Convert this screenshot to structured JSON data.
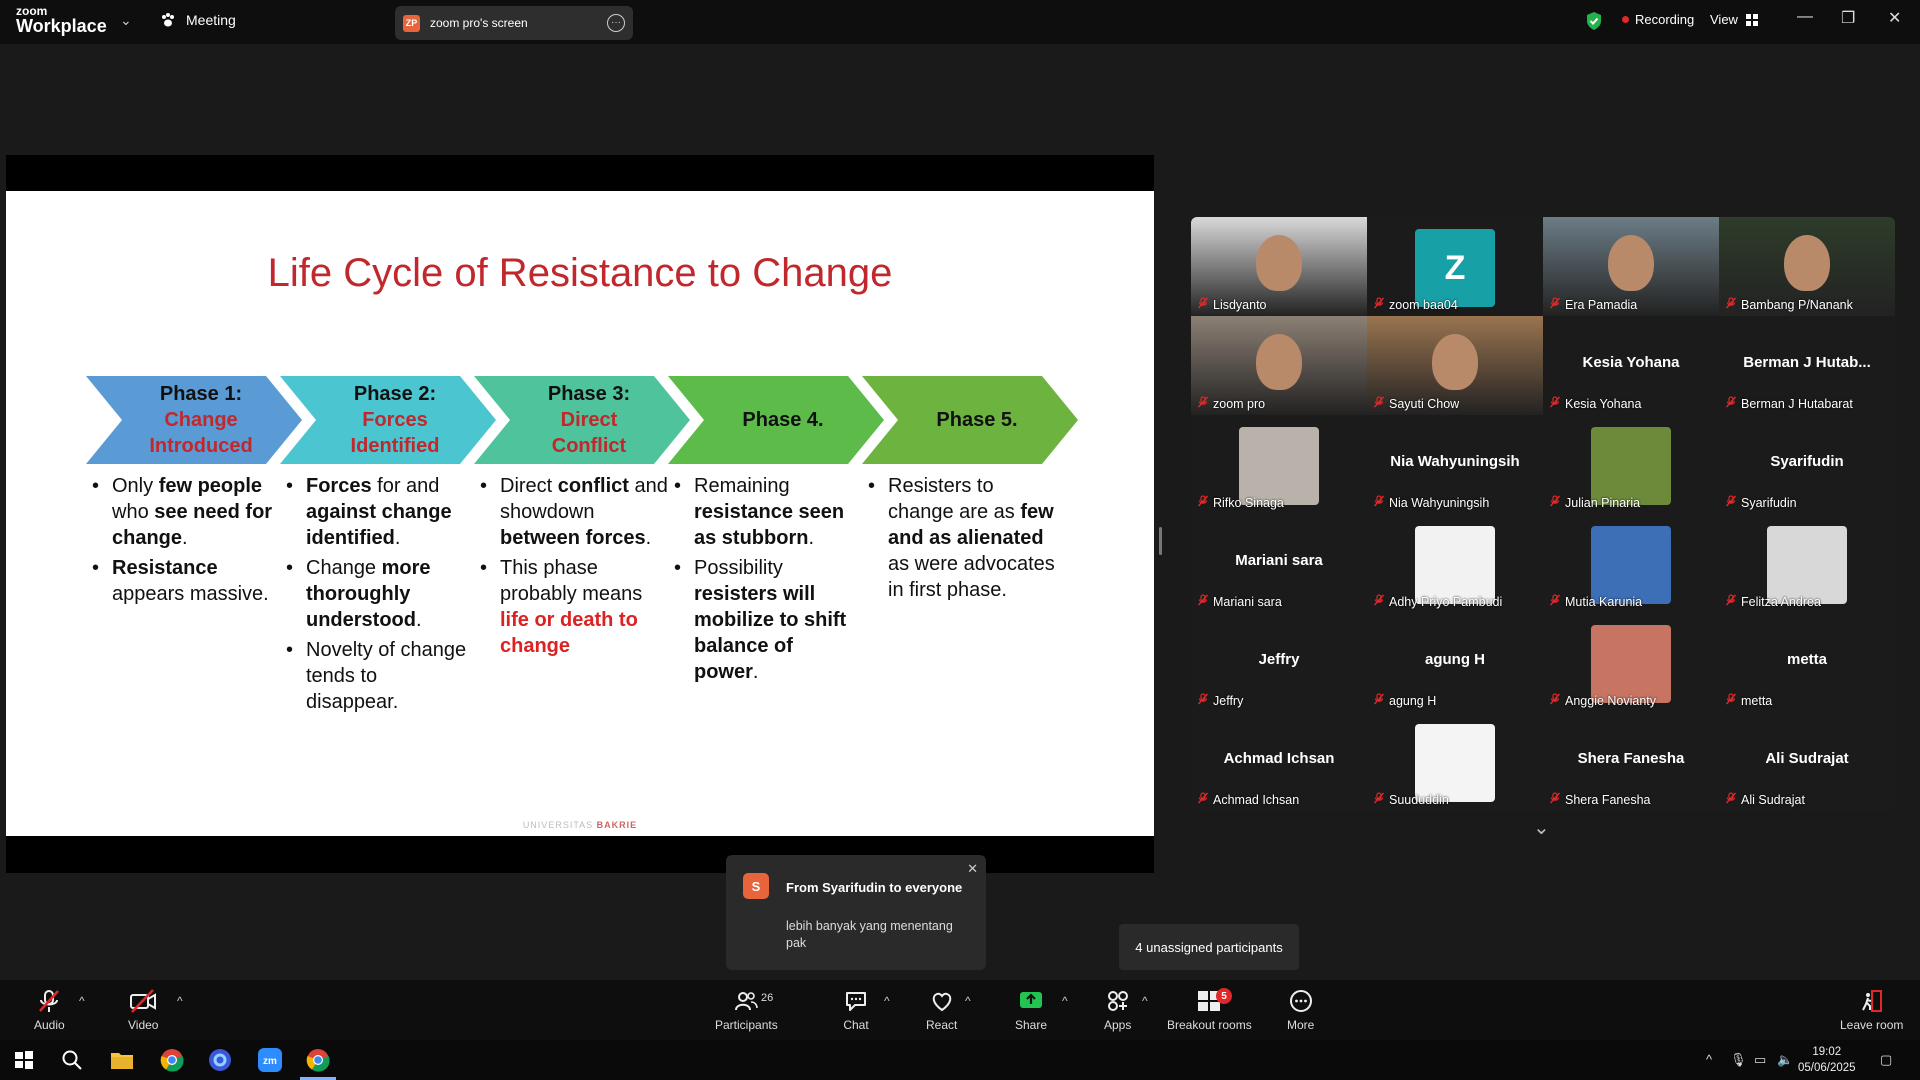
{
  "topbar": {
    "logo_line1": "zoom",
    "logo_line2": "Workplace",
    "meeting_label": "Meeting",
    "share_badge": "ZP",
    "share_title": "zoom pro's screen",
    "recording_label": "Recording",
    "view_label": "View"
  },
  "slide": {
    "title": "Life Cycle of Resistance to Change",
    "phases": [
      {
        "num": "Phase 1:",
        "sub1": "Change",
        "sub2": "Introduced",
        "color": "#5b9bd5"
      },
      {
        "num": "Phase 2:",
        "sub1": "Forces",
        "sub2": "Identified",
        "color": "#4bc6d0"
      },
      {
        "num": "Phase 3:",
        "sub1": "Direct",
        "sub2": "Conflict",
        "color": "#4fc39b"
      },
      {
        "num": "Phase 4.",
        "sub1": "",
        "sub2": "",
        "color": "#5dbb4a"
      },
      {
        "num": "Phase 5.",
        "sub1": "",
        "sub2": "",
        "color": "#6cb33f"
      }
    ],
    "col1": {
      "b1_a": "Only ",
      "b1_b": "few people",
      "b1_c": " who ",
      "b1_d": "see need for change",
      "b1_e": ".",
      "b2_a": "Resistance",
      "b2_b": " appears massive."
    },
    "col2": {
      "b1_a": "Forces",
      "b1_b": " for and ",
      "b1_c": "against change identified",
      "b1_d": ".",
      "b2_a": "Change ",
      "b2_b": "more thoroughly understood",
      "b2_c": ".",
      "b3": "Novelty of change tends to disappear."
    },
    "col3": {
      "b1_a": "Direct ",
      "b1_b": "conflict",
      "b1_c": " and showdown ",
      "b1_d": "between forces",
      "b1_e": ".",
      "b2_a": "This phase probably means ",
      "b2_b": "life or death to change"
    },
    "col4": {
      "b1_a": "Remaining ",
      "b1_b": "resistance seen as stubborn",
      "b1_c": ".",
      "b2_a": "Possibility ",
      "b2_b": "resisters will mobilize to shift balance of power",
      "b2_c": "."
    },
    "col5": {
      "b1_a": "Resisters to change are as ",
      "b1_b": "few and as alienated",
      "b1_c": " as were advocates in first phase."
    },
    "footer_a": "UNIVERSITAS",
    "footer_b": "BAKRIE"
  },
  "participants_gallery": [
    {
      "label": "Lisdyanto",
      "center": "",
      "type": "video",
      "bg": "#d9d9d9"
    },
    {
      "label": "zoom baa04",
      "center": "",
      "type": "avatar",
      "avatar_letter": "Z",
      "bg": "#1b1b1b",
      "avatar_color": "#17a0a6"
    },
    {
      "label": "Era Pamadia",
      "center": "",
      "type": "video",
      "bg": "#6c7d86"
    },
    {
      "label": "Bambang P/Nanank",
      "center": "",
      "type": "video",
      "bg": "#2e3c2a"
    },
    {
      "label": "zoom pro",
      "center": "",
      "type": "video",
      "bg": "#8c8074",
      "active": true
    },
    {
      "label": "Sayuti Chow",
      "center": "",
      "type": "video",
      "bg": "#9a7450"
    },
    {
      "label": "Kesia Yohana",
      "center": "Kesia Yohana",
      "type": "name"
    },
    {
      "label": "Berman J Hutabarat",
      "center": "Berman J Hutab...",
      "type": "name"
    },
    {
      "label": "Rifko Sinaga",
      "center": "",
      "type": "avatar",
      "bg": "#1b1b1b",
      "avatar_color": "#b9b2aa"
    },
    {
      "label": "Nia Wahyuningsih",
      "center": "Nia Wahyuningsih",
      "type": "name"
    },
    {
      "label": "Julian Pinaria",
      "center": "",
      "type": "avatar",
      "bg": "#1b1b1b",
      "avatar_color": "#6d8a3a"
    },
    {
      "label": "Syarifudin",
      "center": "Syarifudin",
      "type": "name"
    },
    {
      "label": "Mariani sara",
      "center": "Mariani sara",
      "type": "name"
    },
    {
      "label": "Adhy Priyo Pambudi",
      "center": "",
      "type": "avatar",
      "bg": "#1b1b1b",
      "avatar_color": "#f2f2f2"
    },
    {
      "label": "Mutia Karunia",
      "center": "",
      "type": "avatar",
      "bg": "#1b1b1b",
      "avatar_color": "#3d6fb6"
    },
    {
      "label": "Felitza Andrea",
      "center": "",
      "type": "avatar",
      "bg": "#1b1b1b",
      "avatar_color": "#d8d8d8"
    },
    {
      "label": "Jeffry",
      "center": "Jeffry",
      "type": "name"
    },
    {
      "label": "agung H",
      "center": "agung H",
      "type": "name"
    },
    {
      "label": "Anggie Novianty",
      "center": "",
      "type": "avatar",
      "bg": "#1b1b1b",
      "avatar_color": "#c77463"
    },
    {
      "label": "metta",
      "center": "metta",
      "type": "name"
    },
    {
      "label": "Achmad Ichsan",
      "center": "Achmad Ichsan",
      "type": "name"
    },
    {
      "label": "Suududdin",
      "center": "",
      "type": "avatar",
      "bg": "#1b1b1b",
      "avatar_color": "#f4f4f4"
    },
    {
      "label": "Shera Fanesha",
      "center": "Shera Fanesha",
      "type": "name"
    },
    {
      "label": "Ali Sudrajat",
      "center": "Ali Sudrajat",
      "type": "name"
    }
  ],
  "chat_toast": {
    "avatar": "S",
    "from": "From Syarifudin to everyone",
    "message": "lebih banyak yang menentang pak"
  },
  "unassigned": "4 unassigned participants",
  "toolbar": {
    "audio": "Audio",
    "video": "Video",
    "participants": "Participants",
    "participants_count": "26",
    "chat": "Chat",
    "react": "React",
    "share": "Share",
    "apps": "Apps",
    "breakout": "Breakout rooms",
    "breakout_badge": "5",
    "more": "More",
    "leave": "Leave room"
  },
  "taskbar": {
    "time": "19:02",
    "date": "05/06/2025"
  }
}
